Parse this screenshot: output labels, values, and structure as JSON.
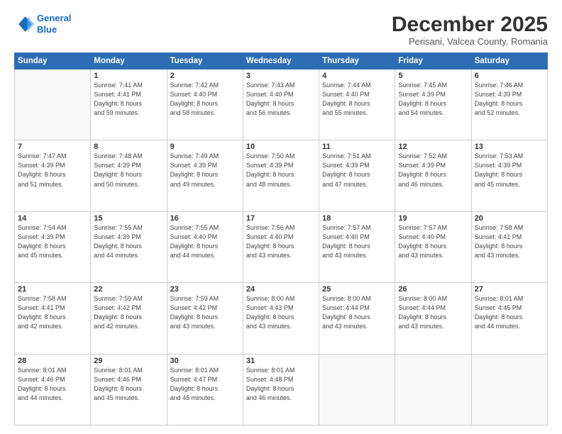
{
  "header": {
    "logo_line1": "General",
    "logo_line2": "Blue",
    "month": "December 2025",
    "location": "Perisani, Valcea County, Romania"
  },
  "weekdays": [
    "Sunday",
    "Monday",
    "Tuesday",
    "Wednesday",
    "Thursday",
    "Friday",
    "Saturday"
  ],
  "weeks": [
    [
      {
        "day": "",
        "info": ""
      },
      {
        "day": "1",
        "info": "Sunrise: 7:41 AM\nSunset: 4:41 PM\nDaylight: 8 hours\nand 59 minutes."
      },
      {
        "day": "2",
        "info": "Sunrise: 7:42 AM\nSunset: 4:40 PM\nDaylight: 8 hours\nand 58 minutes."
      },
      {
        "day": "3",
        "info": "Sunrise: 7:43 AM\nSunset: 4:40 PM\nDaylight: 8 hours\nand 56 minutes."
      },
      {
        "day": "4",
        "info": "Sunrise: 7:44 AM\nSunset: 4:40 PM\nDaylight: 8 hours\nand 55 minutes."
      },
      {
        "day": "5",
        "info": "Sunrise: 7:45 AM\nSunset: 4:39 PM\nDaylight: 8 hours\nand 54 minutes."
      },
      {
        "day": "6",
        "info": "Sunrise: 7:46 AM\nSunset: 4:39 PM\nDaylight: 8 hours\nand 52 minutes."
      }
    ],
    [
      {
        "day": "7",
        "info": "Sunrise: 7:47 AM\nSunset: 4:39 PM\nDaylight: 8 hours\nand 51 minutes."
      },
      {
        "day": "8",
        "info": "Sunrise: 7:48 AM\nSunset: 4:39 PM\nDaylight: 8 hours\nand 50 minutes."
      },
      {
        "day": "9",
        "info": "Sunrise: 7:49 AM\nSunset: 4:39 PM\nDaylight: 8 hours\nand 49 minutes."
      },
      {
        "day": "10",
        "info": "Sunrise: 7:50 AM\nSunset: 4:39 PM\nDaylight: 8 hours\nand 48 minutes."
      },
      {
        "day": "11",
        "info": "Sunrise: 7:51 AM\nSunset: 4:39 PM\nDaylight: 8 hours\nand 47 minutes."
      },
      {
        "day": "12",
        "info": "Sunrise: 7:52 AM\nSunset: 4:39 PM\nDaylight: 8 hours\nand 46 minutes."
      },
      {
        "day": "13",
        "info": "Sunrise: 7:53 AM\nSunset: 4:39 PM\nDaylight: 8 hours\nand 45 minutes."
      }
    ],
    [
      {
        "day": "14",
        "info": "Sunrise: 7:54 AM\nSunset: 4:39 PM\nDaylight: 8 hours\nand 45 minutes."
      },
      {
        "day": "15",
        "info": "Sunrise: 7:55 AM\nSunset: 4:39 PM\nDaylight: 8 hours\nand 44 minutes."
      },
      {
        "day": "16",
        "info": "Sunrise: 7:55 AM\nSunset: 4:40 PM\nDaylight: 8 hours\nand 44 minutes."
      },
      {
        "day": "17",
        "info": "Sunrise: 7:56 AM\nSunset: 4:40 PM\nDaylight: 8 hours\nand 43 minutes."
      },
      {
        "day": "18",
        "info": "Sunrise: 7:57 AM\nSunset: 4:40 PM\nDaylight: 8 hours\nand 43 minutes."
      },
      {
        "day": "19",
        "info": "Sunrise: 7:57 AM\nSunset: 4:40 PM\nDaylight: 8 hours\nand 43 minutes."
      },
      {
        "day": "20",
        "info": "Sunrise: 7:58 AM\nSunset: 4:41 PM\nDaylight: 8 hours\nand 43 minutes."
      }
    ],
    [
      {
        "day": "21",
        "info": "Sunrise: 7:58 AM\nSunset: 4:41 PM\nDaylight: 8 hours\nand 42 minutes."
      },
      {
        "day": "22",
        "info": "Sunrise: 7:59 AM\nSunset: 4:42 PM\nDaylight: 8 hours\nand 42 minutes."
      },
      {
        "day": "23",
        "info": "Sunrise: 7:59 AM\nSunset: 4:42 PM\nDaylight: 8 hours\nand 43 minutes."
      },
      {
        "day": "24",
        "info": "Sunrise: 8:00 AM\nSunset: 4:43 PM\nDaylight: 8 hours\nand 43 minutes."
      },
      {
        "day": "25",
        "info": "Sunrise: 8:00 AM\nSunset: 4:44 PM\nDaylight: 8 hours\nand 43 minutes."
      },
      {
        "day": "26",
        "info": "Sunrise: 8:00 AM\nSunset: 4:44 PM\nDaylight: 8 hours\nand 43 minutes."
      },
      {
        "day": "27",
        "info": "Sunrise: 8:01 AM\nSunset: 4:45 PM\nDaylight: 8 hours\nand 44 minutes."
      }
    ],
    [
      {
        "day": "28",
        "info": "Sunrise: 8:01 AM\nSunset: 4:46 PM\nDaylight: 8 hours\nand 44 minutes."
      },
      {
        "day": "29",
        "info": "Sunrise: 8:01 AM\nSunset: 4:46 PM\nDaylight: 8 hours\nand 45 minutes."
      },
      {
        "day": "30",
        "info": "Sunrise: 8:01 AM\nSunset: 4:47 PM\nDaylight: 8 hours\nand 45 minutes."
      },
      {
        "day": "31",
        "info": "Sunrise: 8:01 AM\nSunset: 4:48 PM\nDaylight: 8 hours\nand 46 minutes."
      },
      {
        "day": "",
        "info": ""
      },
      {
        "day": "",
        "info": ""
      },
      {
        "day": "",
        "info": ""
      }
    ]
  ]
}
